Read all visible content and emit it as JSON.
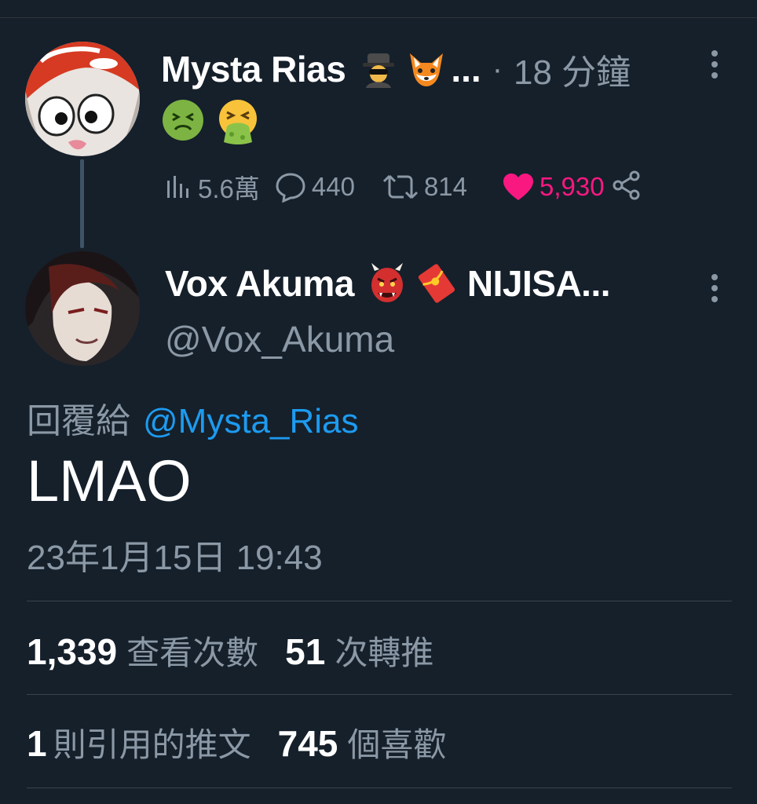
{
  "parent_tweet": {
    "author_name": "Mysta Rias",
    "name_emojis": [
      "spy-emoji",
      "fox-emoji"
    ],
    "name_truncation": "...",
    "separator": "·",
    "time_ago": "18 分鐘",
    "body_emojis": [
      "nauseated-face-emoji",
      "vomiting-face-emoji"
    ],
    "stats": {
      "views": "5.6萬",
      "replies": "440",
      "retweets": "814",
      "likes": "5,930"
    }
  },
  "reply_tweet": {
    "author_name": "Vox Akuma",
    "name_emojis": [
      "ogre-emoji",
      "red-envelope-emoji"
    ],
    "name_suffix": "NIJISA...",
    "handle": "@Vox_Akuma",
    "reply_to_label": "回覆給",
    "reply_to_handle": "@Mysta_Rias",
    "text": "LMAO",
    "timestamp": "23年1月15日 19:43",
    "metrics": {
      "views_count": "1,339",
      "views_label": "查看次數",
      "retweets_count": "51",
      "retweets_label": "次轉推",
      "quotes_count": "1",
      "quotes_label": "則引用的推文",
      "likes_count": "745",
      "likes_label": "個喜歡"
    }
  },
  "colors": {
    "background": "#15202b",
    "primary_text": "#ffffff",
    "secondary_text": "#8b98a5",
    "link": "#1d9bf0",
    "like": "#f91880"
  }
}
